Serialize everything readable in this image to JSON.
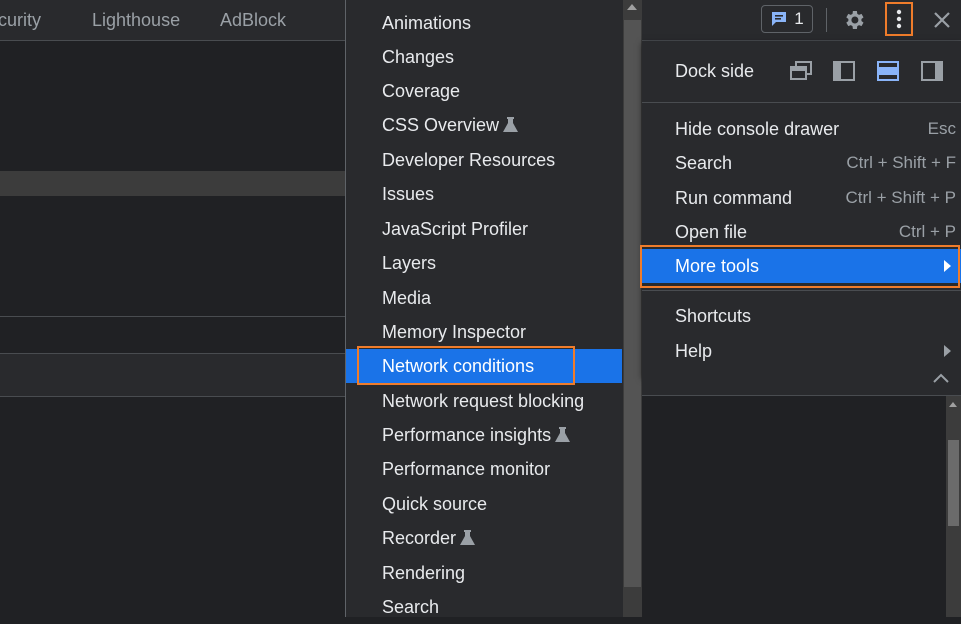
{
  "tabs": [
    "curity",
    "Lighthouse",
    "AdBlock"
  ],
  "submenu": {
    "items": [
      {
        "label": "Animations",
        "experimental": false
      },
      {
        "label": "Changes",
        "experimental": false
      },
      {
        "label": "Coverage",
        "experimental": false
      },
      {
        "label": "CSS Overview",
        "experimental": true
      },
      {
        "label": "Developer Resources",
        "experimental": false
      },
      {
        "label": "Issues",
        "experimental": false
      },
      {
        "label": "JavaScript Profiler",
        "experimental": false
      },
      {
        "label": "Layers",
        "experimental": false
      },
      {
        "label": "Media",
        "experimental": false
      },
      {
        "label": "Memory Inspector",
        "experimental": false
      },
      {
        "label": "Network conditions",
        "experimental": false,
        "selected": true
      },
      {
        "label": "Network request blocking",
        "experimental": false
      },
      {
        "label": "Performance insights",
        "experimental": true
      },
      {
        "label": "Performance monitor",
        "experimental": false
      },
      {
        "label": "Quick source",
        "experimental": false
      },
      {
        "label": "Recorder",
        "experimental": true
      },
      {
        "label": "Rendering",
        "experimental": false
      },
      {
        "label": "Search",
        "experimental": false
      }
    ]
  },
  "toolbar": {
    "issues_count": "1",
    "icons": [
      "issues-icon",
      "gear-icon",
      "kebab-menu-icon",
      "close-icon"
    ]
  },
  "menu": {
    "dock_side_label": "Dock side",
    "dock_options": [
      "undock-icon",
      "dock-left-icon",
      "dock-bottom-icon",
      "dock-right-icon"
    ],
    "dock_selected": "dock-bottom-icon",
    "items": [
      {
        "label": "Hide console drawer",
        "shortcut": "Esc"
      },
      {
        "label": "Search",
        "shortcut": "Ctrl + Shift + F"
      },
      {
        "label": "Run command",
        "shortcut": "Ctrl + Shift + P"
      },
      {
        "label": "Open file",
        "shortcut": "Ctrl + P"
      },
      {
        "label": "More tools",
        "shortcut": "",
        "submenu": true,
        "selected": true
      },
      {
        "label": "Shortcuts",
        "shortcut": ""
      },
      {
        "label": "Help",
        "shortcut": "",
        "submenu": true
      }
    ]
  },
  "colors": {
    "accent": "#1a73e8",
    "highlight_outline": "#ef7c2b",
    "menu_bg": "#292a2d",
    "page_bg": "#202124"
  }
}
